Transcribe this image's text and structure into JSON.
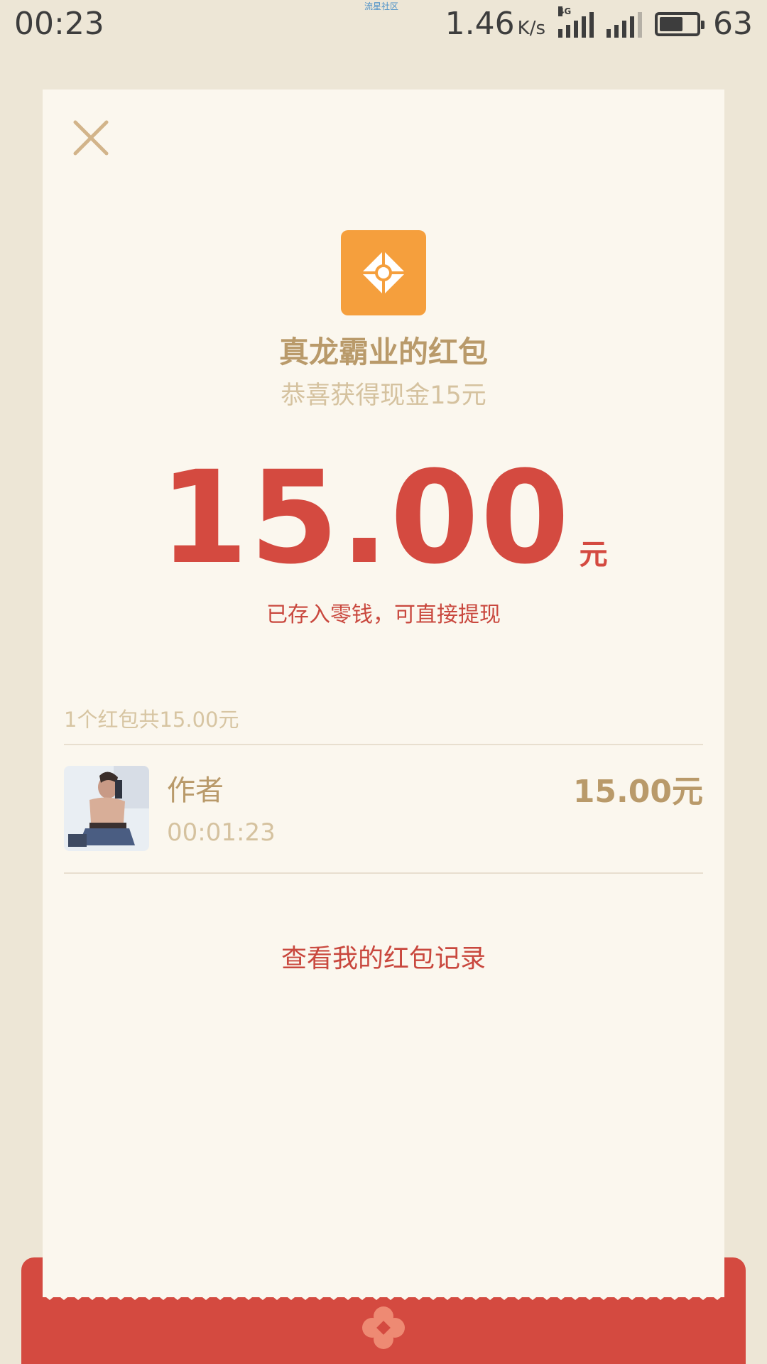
{
  "status_bar": {
    "time": "00:23",
    "watermark": "流星社区",
    "net_speed": "1.46",
    "net_speed_unit": "K/s",
    "network_type": "4G",
    "battery_level": "63"
  },
  "header": {
    "close_icon": "close-icon",
    "logo_icon": "red-packet-app-logo-icon"
  },
  "packet": {
    "title": "真龙霸业的红包",
    "subtitle": "恭喜获得现金15元",
    "amount": "15.00",
    "amount_unit": "元",
    "note": "已存入零钱，可直接提现"
  },
  "records": {
    "summary": "1个红包共15.00元",
    "items": [
      {
        "name": "作者",
        "time": "00:01:23",
        "amount": "15.00元"
      }
    ]
  },
  "footer": {
    "history_link": "查看我的红包记录"
  },
  "colors": {
    "accent_red": "#d44a40",
    "gold_text": "#b99a6a",
    "card_bg": "#fbf7ee",
    "page_bg": "#ede6d6",
    "logo_orange": "#f59f3d"
  }
}
